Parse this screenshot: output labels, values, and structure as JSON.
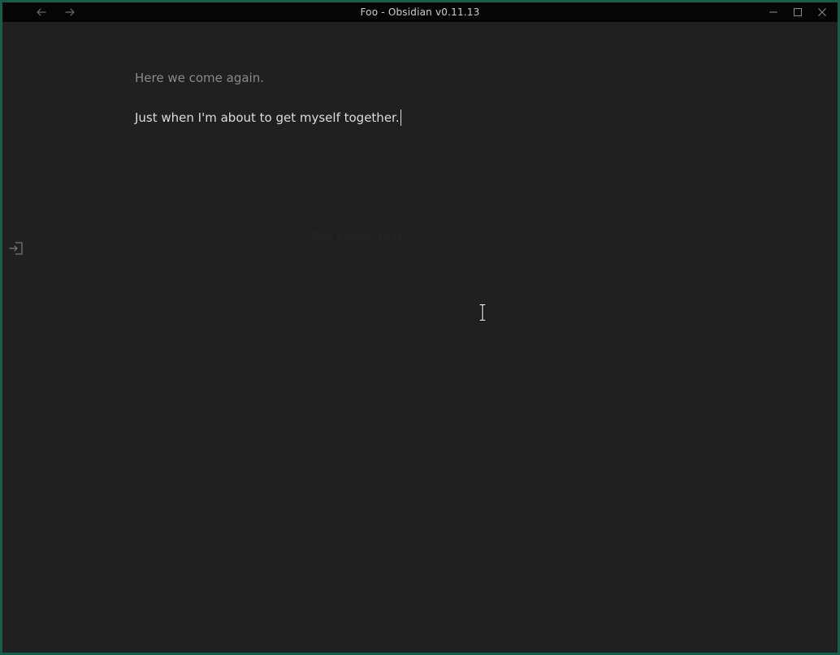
{
  "window": {
    "title": "Foo - Obsidian v0.11.13"
  },
  "titlebar": {
    "back_icon": "arrow-left-icon",
    "forward_icon": "arrow-right-icon",
    "minimize_icon": "minimize-icon",
    "maximize_icon": "maximize-icon",
    "close_icon": "close-icon"
  },
  "sidebar": {
    "toggle_icon": "sidebar-expand-icon"
  },
  "editor": {
    "lines": [
      "Here we come again.",
      "Just when I'm about to get myself together."
    ],
    "hint": "Take a break, relax..."
  },
  "colors": {
    "desktop": "#1a5c4a",
    "titlebar": "#050505",
    "editor_bg": "#202020",
    "text_normal": "#dcddde",
    "text_muted": "#8a8a8a"
  }
}
